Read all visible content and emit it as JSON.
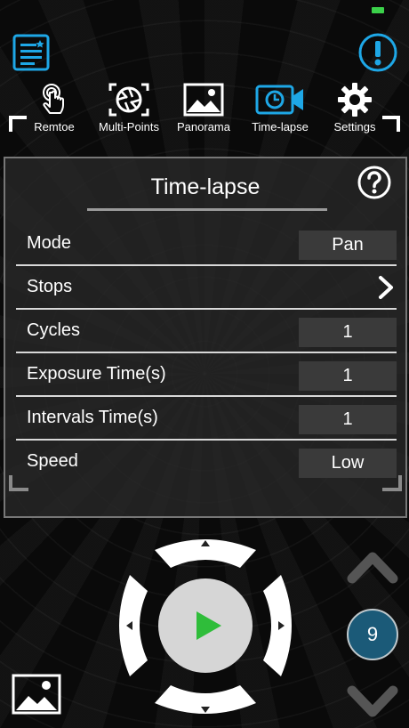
{
  "nav": {
    "items": [
      {
        "label": "Remtoe",
        "icon": "touch-hand-icon",
        "active": false
      },
      {
        "label": "Multi-Points",
        "icon": "aperture-icon",
        "active": false
      },
      {
        "label": "Panorama",
        "icon": "panorama-image-icon",
        "active": false
      },
      {
        "label": "Time-lapse",
        "icon": "timelapse-camera-icon",
        "active": true
      },
      {
        "label": "Settings",
        "icon": "gear-icon",
        "active": false
      }
    ]
  },
  "panel": {
    "title": "Time-lapse",
    "rows": [
      {
        "label": "Mode",
        "value": "Pan"
      },
      {
        "label": "Stops",
        "value": ""
      },
      {
        "label": "Cycles",
        "value": "1"
      },
      {
        "label": "Exposure Time(s)",
        "value": "1"
      },
      {
        "label": "Intervals Time(s)",
        "value": "1"
      },
      {
        "label": "Speed",
        "value": "Low"
      }
    ]
  },
  "controls": {
    "count": "9"
  },
  "colors": {
    "accent": "#1ea7e6",
    "play": "#2fbd3a",
    "battery": "#3bd14a",
    "badge": "#1b5a78"
  }
}
